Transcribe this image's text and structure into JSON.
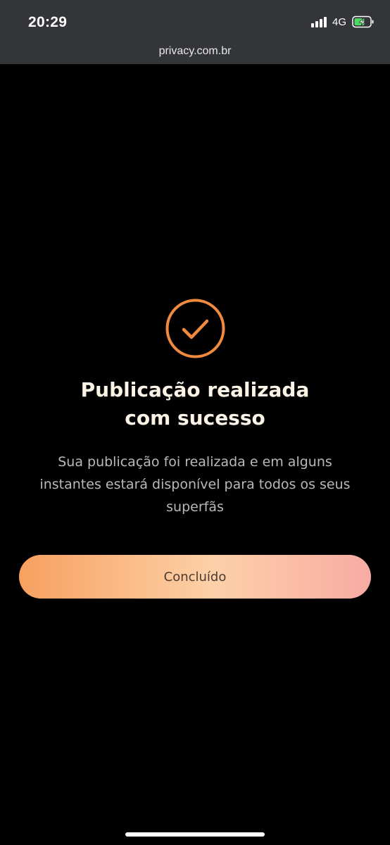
{
  "status_bar": {
    "time": "20:29",
    "network": "4G",
    "icons": [
      "signal-icon",
      "battery-charging-icon"
    ]
  },
  "browser": {
    "url": "privacy.com.br"
  },
  "success": {
    "icon": "check-circle-icon",
    "title_line1": "Publicação realizada",
    "title_line2": "com sucesso",
    "message": "Sua publicação foi realizada e em alguns instantes estará disponível para todos os seus superfãs",
    "button_label": "Concluído"
  },
  "colors": {
    "accent": "#f08a3e",
    "title": "#fbf3e6",
    "message": "#b9b9bb",
    "top_bar": "#333538",
    "battery": "#4cd964"
  }
}
